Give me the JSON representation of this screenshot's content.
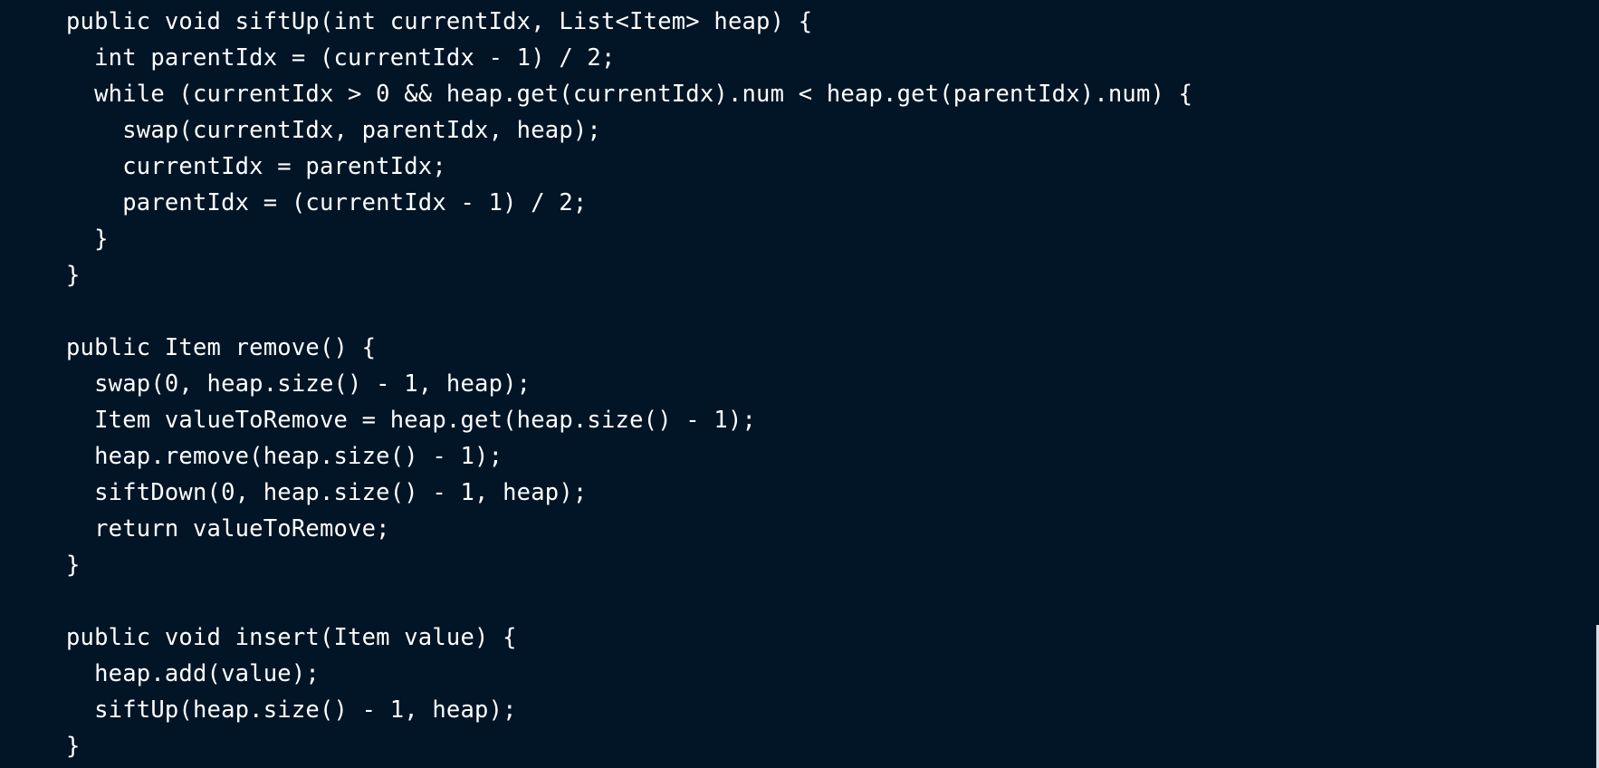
{
  "code": {
    "lines": [
      "public void siftUp(int currentIdx, List<Item> heap) {",
      "  int parentIdx = (currentIdx - 1) / 2;",
      "  while (currentIdx > 0 && heap.get(currentIdx).num < heap.get(parentIdx).num) {",
      "    swap(currentIdx, parentIdx, heap);",
      "    currentIdx = parentIdx;",
      "    parentIdx = (currentIdx - 1) / 2;",
      "  }",
      "}",
      "",
      "public Item remove() {",
      "  swap(0, heap.size() - 1, heap);",
      "  Item valueToRemove = heap.get(heap.size() - 1);",
      "  heap.remove(heap.size() - 1);",
      "  siftDown(0, heap.size() - 1, heap);",
      "  return valueToRemove;",
      "}",
      "",
      "public void insert(Item value) {",
      "  heap.add(value);",
      "  siftUp(heap.size() - 1, heap);",
      "}"
    ]
  },
  "colors": {
    "background": "#011527",
    "text": "#ffffff"
  }
}
